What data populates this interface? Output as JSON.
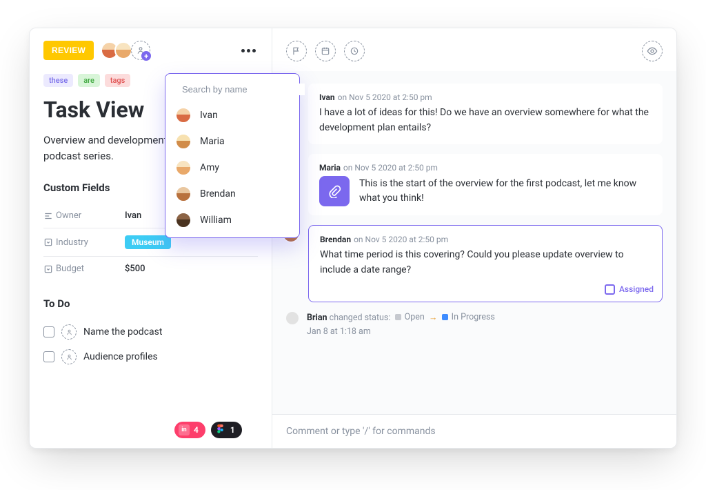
{
  "header": {
    "status_label": "REVIEW"
  },
  "tags": [
    {
      "text": "these",
      "class": "purple"
    },
    {
      "text": "are",
      "class": "green"
    },
    {
      "text": "tags",
      "class": "red"
    }
  ],
  "task": {
    "title": "Task View",
    "description": "Overview and development plan for original podcast series."
  },
  "custom_fields": {
    "section": "Custom Fields",
    "rows": [
      {
        "icon": "align",
        "label": "Owner",
        "value": "Ivan",
        "type": "text"
      },
      {
        "icon": "select",
        "label": "Industry",
        "value": "Museum",
        "type": "pill"
      },
      {
        "icon": "select",
        "label": "Budget",
        "value": "$500",
        "type": "text"
      }
    ]
  },
  "todo": {
    "section": "To Do",
    "items": [
      {
        "label": "Name the podcast"
      },
      {
        "label": "Audience profiles"
      }
    ]
  },
  "integrations": [
    {
      "icon": "in",
      "count": "4",
      "style": "pk"
    },
    {
      "icon": "figma",
      "count": "1",
      "style": "dk"
    }
  ],
  "popover": {
    "search_placeholder": "Search by name",
    "people": [
      {
        "name": "Ivan",
        "av": "person1"
      },
      {
        "name": "Maria",
        "av": "person2"
      },
      {
        "name": "Amy",
        "av": "person3"
      },
      {
        "name": "Brendan",
        "av": "person4"
      },
      {
        "name": "William",
        "av": "person5"
      }
    ]
  },
  "comments": [
    {
      "author": "Ivan",
      "av": "person1",
      "timestamp": "on Nov 5 2020 at 2:50 pm",
      "body": "I have a lot of ideas for this! Do we have an overview somewhere for what the development plan entails?",
      "kind": "text"
    },
    {
      "author": "Maria",
      "av": "person2",
      "timestamp": "on Nov 5 2020 at 2:50 pm",
      "body": "This is the start of the overview for the first podcast, let me know what you think!",
      "kind": "attachment"
    },
    {
      "author": "Brendan",
      "av": "person4",
      "timestamp": "on Nov 5 2020 at 2:50 pm",
      "body": "What time period is this covering? Could you please update overview to include a date range?",
      "kind": "thread",
      "chip": "Assigned"
    }
  ],
  "activity": {
    "actor": "Brian",
    "text": "changed status:",
    "from": "Open",
    "to": "In Progress",
    "time": "Jan 8 at 1:18 am"
  },
  "composer": {
    "placeholder": "Comment or type '/' for commands"
  }
}
